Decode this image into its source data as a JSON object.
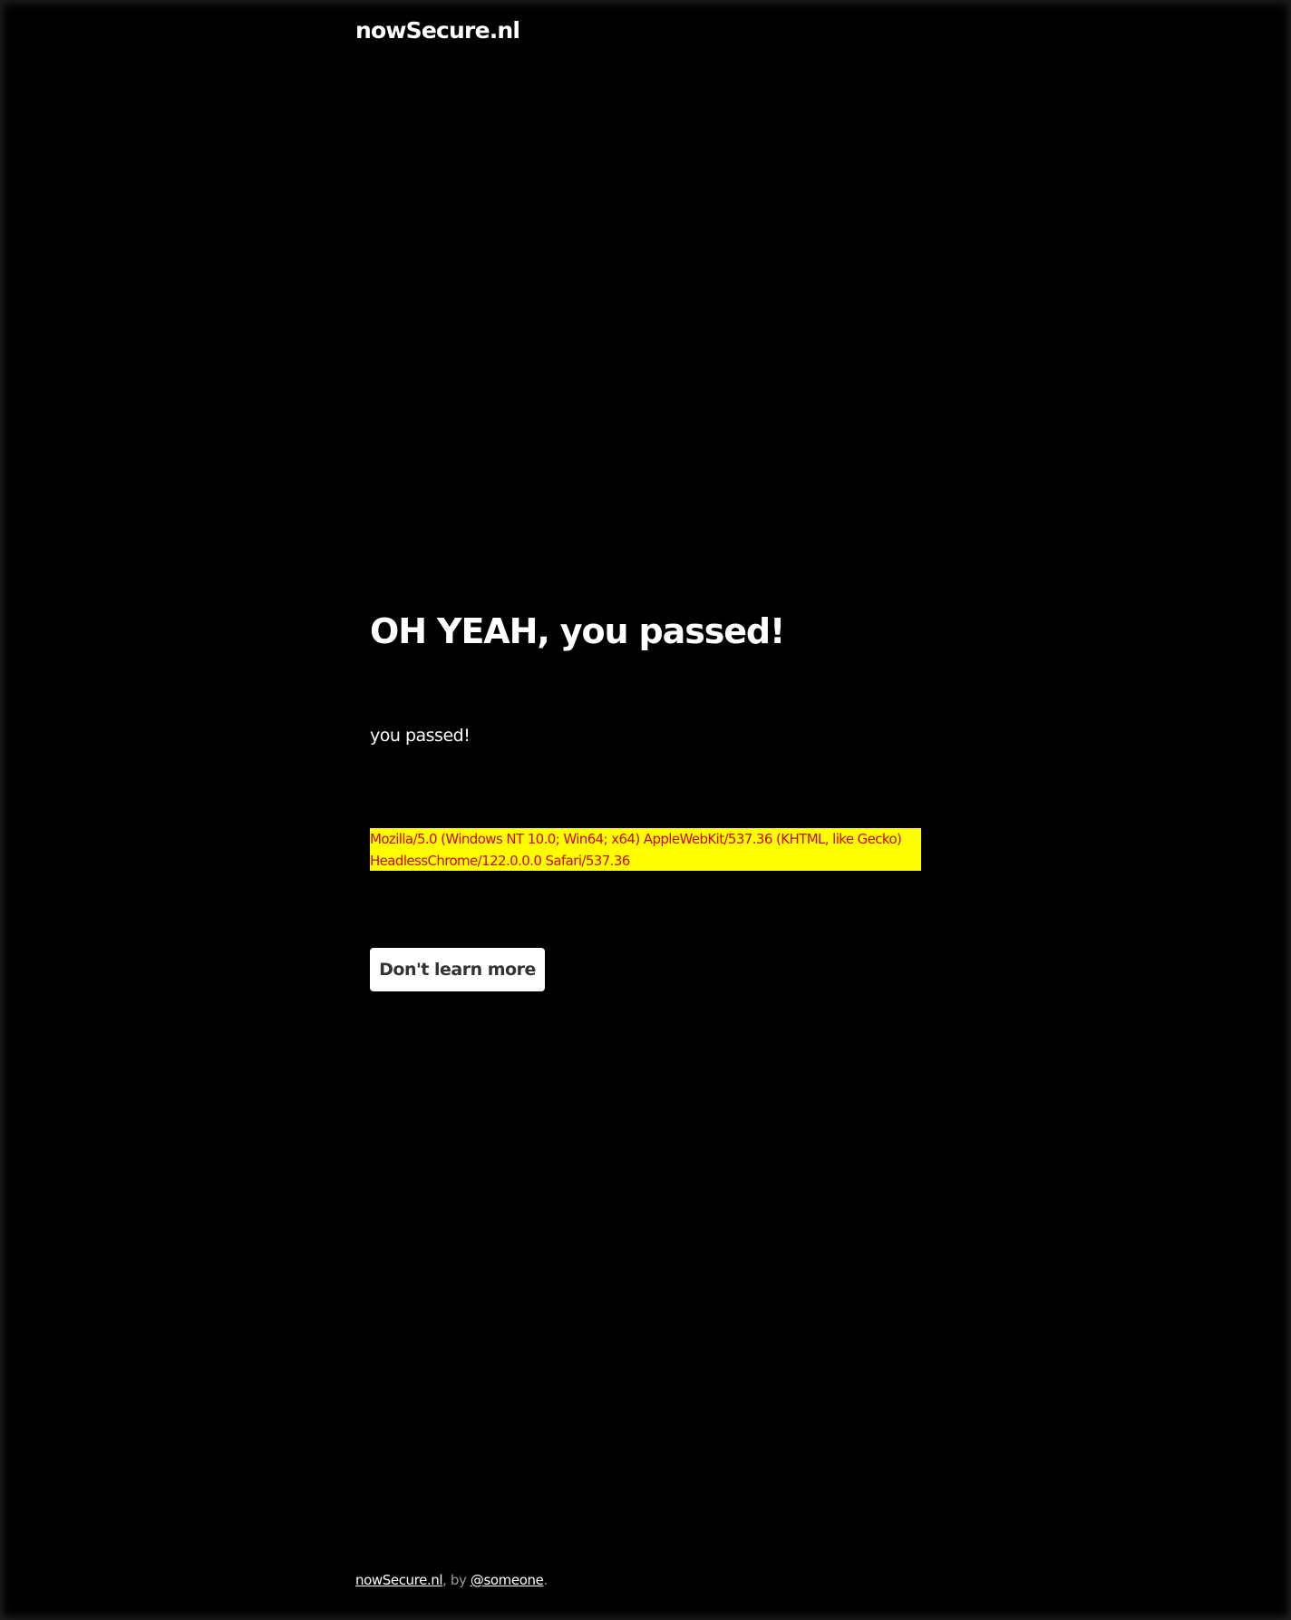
{
  "header": {
    "brand": "nowSecure.nl"
  },
  "main": {
    "headline": "OH YEAH, you passed!",
    "subtext": "you passed!",
    "user_agent_lines": [
      "Mozilla/5.0 (Windows NT 10.0; Win64; x64) AppleWebKit/537.36 (KHTML, like Gecko)",
      "HeadlessChrome/122.0.0.0 Safari/537.36"
    ],
    "button_label": "Don't learn more"
  },
  "footer": {
    "site_link": "nowSecure.nl",
    "by_text": ", by ",
    "author_link": "@someone",
    "end_text": "."
  },
  "colors": {
    "background": "#000000",
    "text": "#ffffff",
    "highlight_background": "#ffff00",
    "highlight_text": "#d40000",
    "button_background": "#ffffff",
    "button_text": "#333333"
  }
}
